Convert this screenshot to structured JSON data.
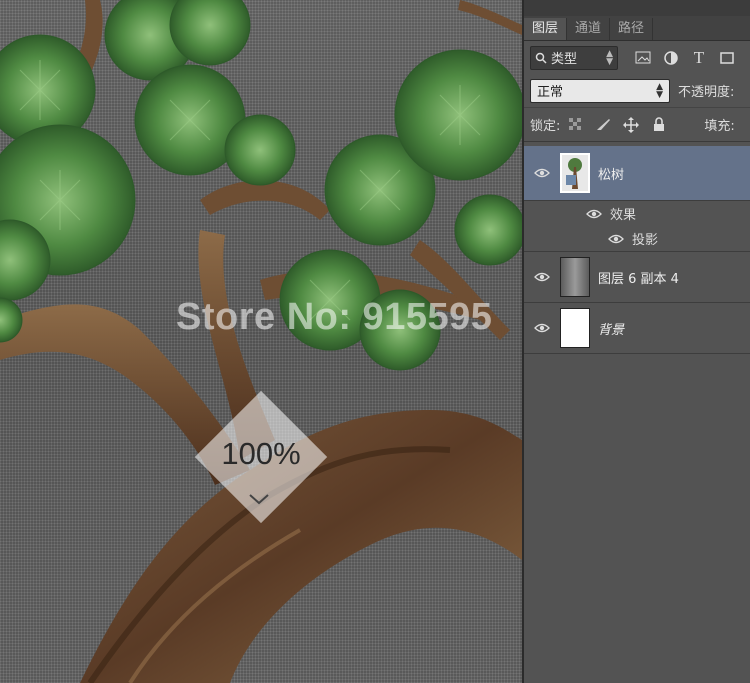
{
  "canvas": {
    "watermark": "Store No: 915595",
    "zoom_level": "100%"
  },
  "panel": {
    "tabs": [
      {
        "label": "图层",
        "active": true
      },
      {
        "label": "通道",
        "active": false
      },
      {
        "label": "路径",
        "active": false
      }
    ],
    "filter": {
      "label": "类型",
      "icons": [
        "image-filter-icon",
        "adjustment-filter-icon",
        "type-filter-icon",
        "shape-filter-icon"
      ]
    },
    "blend_mode": "正常",
    "opacity_label": "不透明度:",
    "lock_label": "锁定:",
    "lock_icons": [
      "lock-transparent-icon",
      "lock-paint-icon",
      "lock-move-icon",
      "lock-all-icon"
    ],
    "fill_label": "填充:",
    "layers": [
      {
        "name": "松树",
        "selected": true,
        "effects_label": "效果",
        "effect": "投影"
      },
      {
        "name": "图层 6 副本 4",
        "selected": false
      },
      {
        "name": "背景",
        "selected": false,
        "italic": true
      }
    ]
  },
  "colors": {
    "panel_bg": "#535353",
    "selected_row": "#64728a",
    "tab_bar": "#424242"
  }
}
